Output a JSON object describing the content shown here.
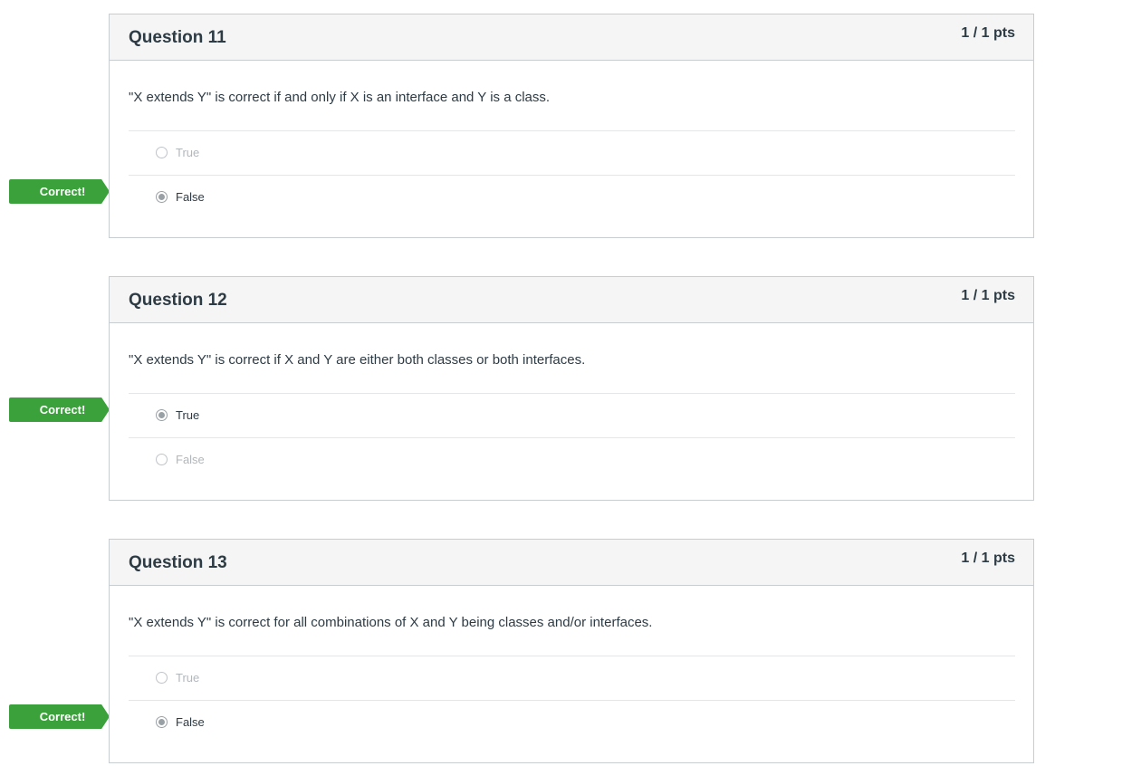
{
  "questions": [
    {
      "title": "Question 11",
      "points": "1 / 1 pts",
      "text": "\"X extends Y\" is correct if and only if X is an interface and Y is a class.",
      "answers": [
        {
          "label": "True",
          "selected": false
        },
        {
          "label": "False",
          "selected": true
        }
      ],
      "feedback": "Correct!"
    },
    {
      "title": "Question 12",
      "points": "1 / 1 pts",
      "text": "\"X extends Y\" is correct if X and Y are either both classes or both interfaces.",
      "answers": [
        {
          "label": "True",
          "selected": true
        },
        {
          "label": "False",
          "selected": false
        }
      ],
      "feedback": "Correct!"
    },
    {
      "title": "Question 13",
      "points": "1 / 1 pts",
      "text": "\"X extends Y\" is correct for all combinations of X and Y being classes and/or interfaces.",
      "answers": [
        {
          "label": "True",
          "selected": false
        },
        {
          "label": "False",
          "selected": true
        }
      ],
      "feedback": "Correct!"
    }
  ],
  "colors": {
    "correct_flag": "#3ba13b",
    "header_bg": "#f5f5f5",
    "border": "#c7cdd1",
    "text": "#2d3b45"
  }
}
